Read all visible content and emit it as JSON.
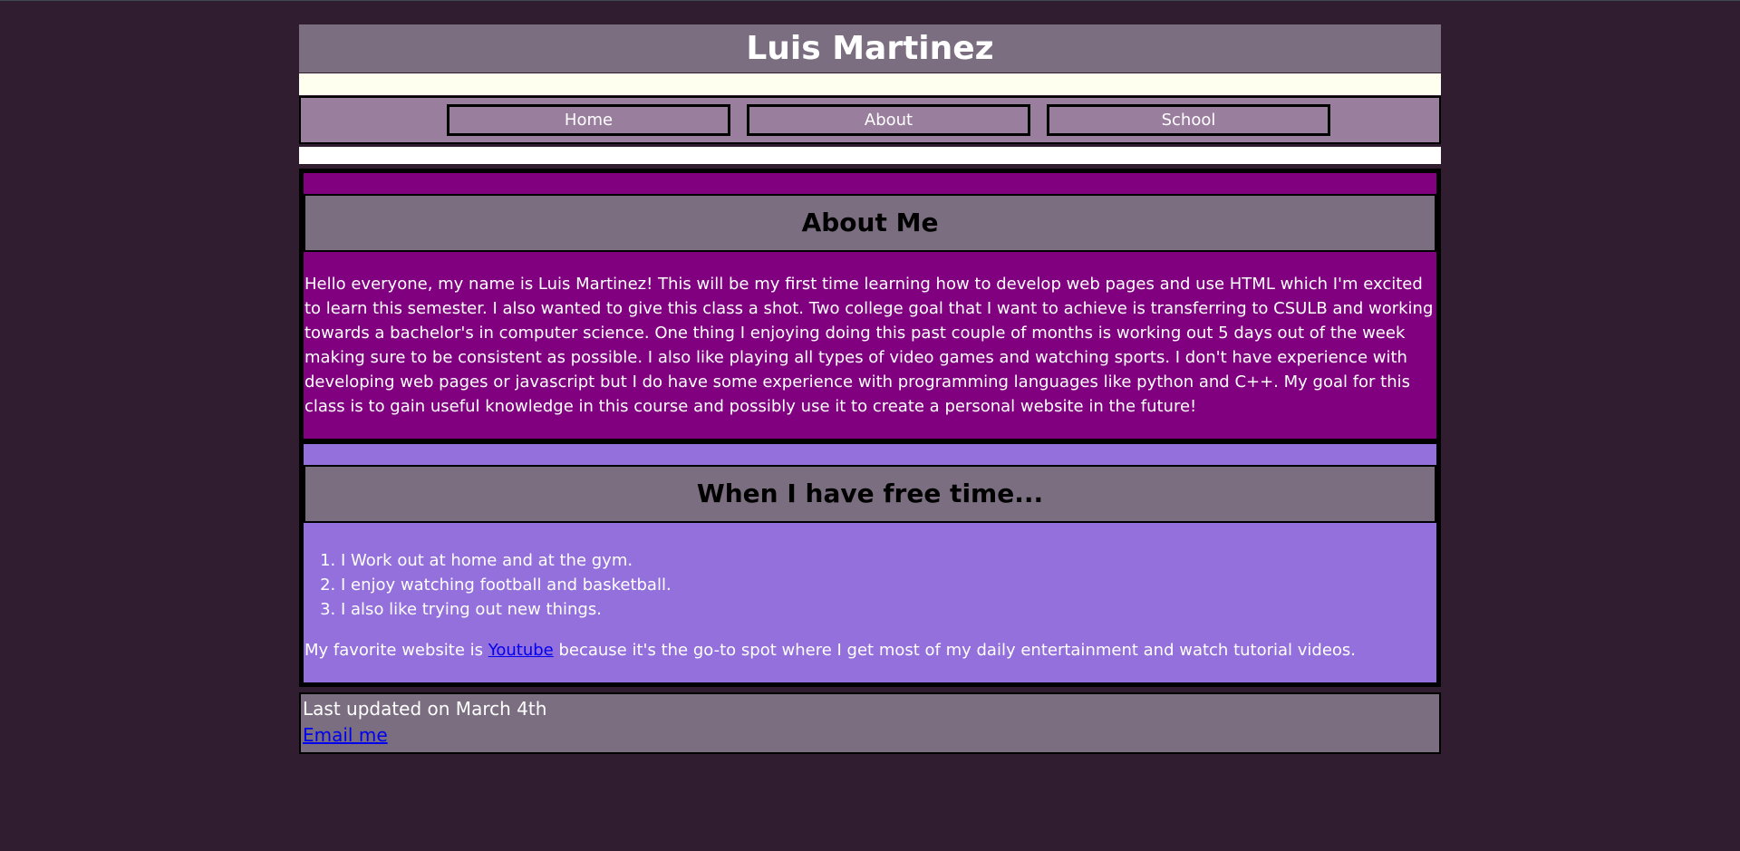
{
  "header": {
    "title": "Luis Martinez"
  },
  "nav": {
    "items": [
      {
        "label": "Home"
      },
      {
        "label": "About"
      },
      {
        "label": "School"
      }
    ]
  },
  "about": {
    "heading": "About Me",
    "paragraph": "Hello everyone, my name is Luis Martinez! This will be my first time learning how to develop web pages and use HTML which I'm excited to learn this semester. I also wanted to give this class a shot. Two college goal that I want to achieve is transferring to CSULB and working towards a bachelor's in computer science. One thing I enjoying doing this past couple of months is working out 5 days out of the week making sure to be consistent as possible. I also like playing all types of video games and watching sports. I don't have experience with developing web pages or javascript but I do have some experience with programming languages like python and C++. My goal for this class is to gain useful knowledge in this course and possibly use it to create a personal website in the future!"
  },
  "free_time": {
    "heading": "When I have free time...",
    "items": [
      "I Work out at home and at the gym.",
      "I enjoy watching football and basketball.",
      "I also like trying out new things."
    ],
    "favorite_prefix": "My favorite website is ",
    "favorite_link": "Youtube",
    "favorite_suffix": " because it's the go-to spot where I get most of my daily entertainment and watch tutorial videos."
  },
  "footer": {
    "updated": "Last updated on March 4th",
    "email_link": "Email me"
  },
  "colors": {
    "page_bg": "#311d30",
    "header_bg": "#7a6e80",
    "nav_bg": "#9a7e9e",
    "about_bg": "#800080",
    "free_bg": "#9370db",
    "link": "#0000ee"
  }
}
